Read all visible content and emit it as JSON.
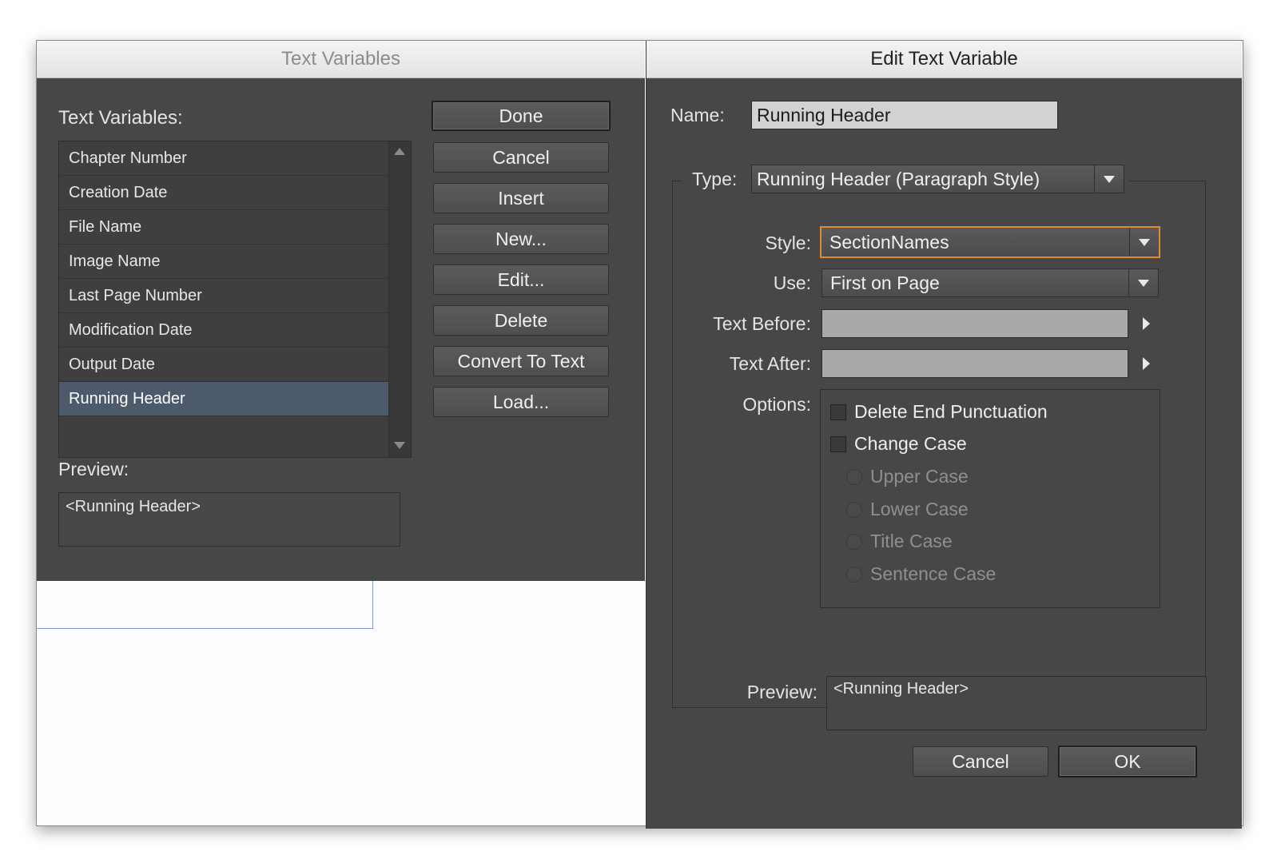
{
  "text_variables_dialog": {
    "title": "Text Variables",
    "list_label": "Text Variables:",
    "items": [
      {
        "label": "Chapter Number",
        "selected": false
      },
      {
        "label": "Creation Date",
        "selected": false
      },
      {
        "label": "File Name",
        "selected": false
      },
      {
        "label": "Image Name",
        "selected": false
      },
      {
        "label": "Last Page Number",
        "selected": false
      },
      {
        "label": "Modification Date",
        "selected": false
      },
      {
        "label": "Output Date",
        "selected": false
      },
      {
        "label": "Running Header",
        "selected": true
      }
    ],
    "preview_label": "Preview:",
    "preview_text": "<Running Header>",
    "buttons": {
      "done": "Done",
      "cancel": "Cancel",
      "insert": "Insert",
      "new": "New...",
      "edit": "Edit...",
      "delete": "Delete",
      "convert": "Convert To Text",
      "load": "Load..."
    }
  },
  "edit_dialog": {
    "title": "Edit Text Variable",
    "name_label": "Name:",
    "name_value": "Running Header",
    "type_label": "Type:",
    "type_value": "Running Header (Paragraph Style)",
    "style_label": "Style:",
    "style_value": "SectionNames",
    "use_label": "Use:",
    "use_value": "First on Page",
    "text_before_label": "Text Before:",
    "text_before_value": "",
    "text_after_label": "Text After:",
    "text_after_value": "",
    "options_label": "Options:",
    "options": {
      "delete_end_punctuation": {
        "label": "Delete End Punctuation",
        "checked": false
      },
      "change_case": {
        "label": "Change Case",
        "checked": false
      },
      "upper_case": {
        "label": "Upper Case",
        "enabled": false
      },
      "lower_case": {
        "label": "Lower Case",
        "enabled": false
      },
      "title_case": {
        "label": "Title Case",
        "enabled": false
      },
      "sentence_case": {
        "label": "Sentence Case",
        "enabled": false
      }
    },
    "preview_label": "Preview:",
    "preview_text": "<Running Header>",
    "buttons": {
      "cancel": "Cancel",
      "ok": "OK"
    }
  },
  "colors": {
    "dialog_bg": "#474747",
    "selection": "#4d5a6b",
    "focus_ring": "#e38a2c"
  }
}
